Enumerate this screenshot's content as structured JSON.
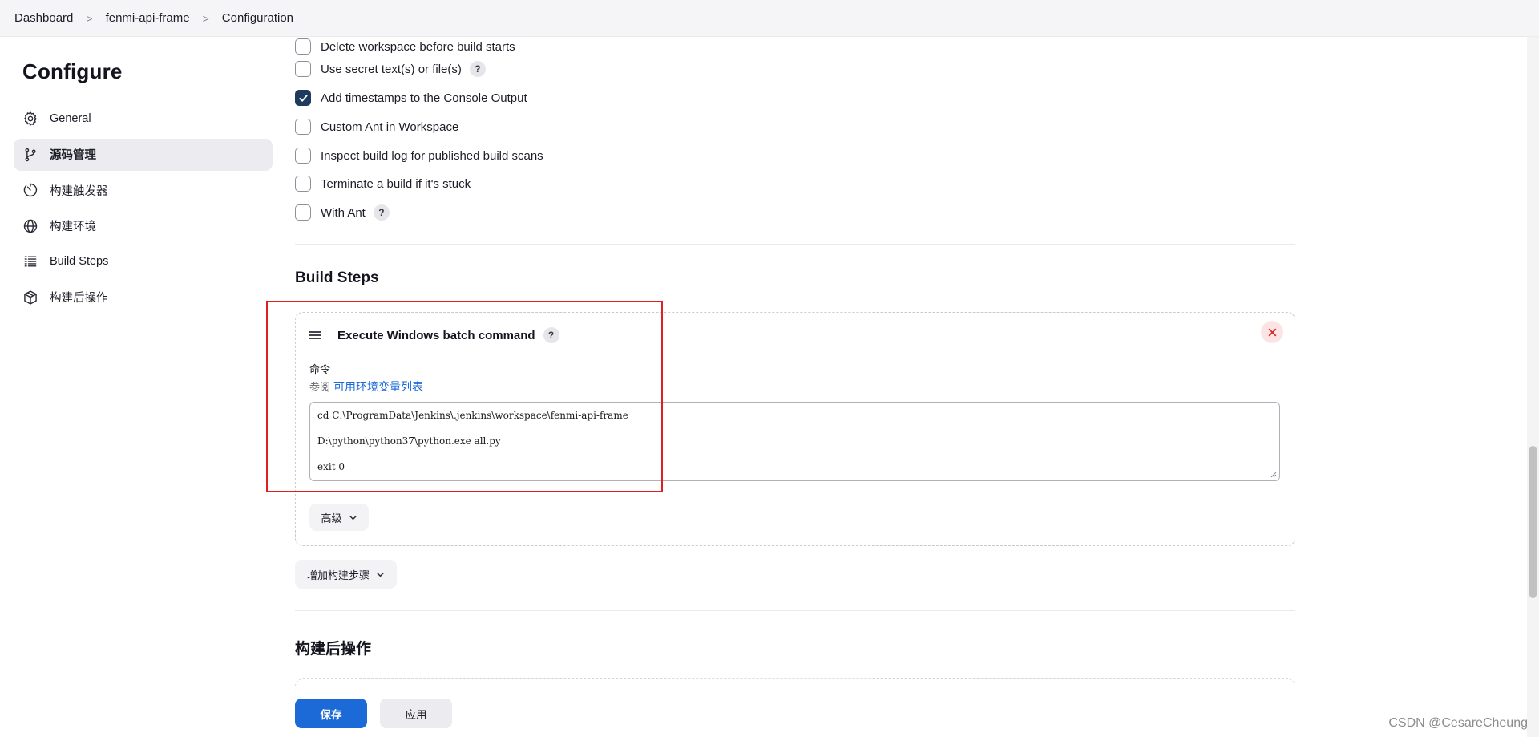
{
  "breadcrumb": {
    "items": [
      "Dashboard",
      "fenmi-api-frame",
      "Configuration"
    ],
    "separator": ">"
  },
  "sidebar": {
    "title": "Configure",
    "items": [
      {
        "label": "General",
        "icon": "gear-icon",
        "active": false
      },
      {
        "label": "源码管理",
        "icon": "git-branch-icon",
        "active": true
      },
      {
        "label": "构建触发器",
        "icon": "timer-icon",
        "active": false
      },
      {
        "label": "构建环境",
        "icon": "globe-icon",
        "active": false
      },
      {
        "label": "Build Steps",
        "icon": "list-icon",
        "active": false
      },
      {
        "label": "构建后操作",
        "icon": "package-icon",
        "active": false
      }
    ]
  },
  "options": [
    {
      "label": "Delete workspace before build starts",
      "checked": false,
      "help": false
    },
    {
      "label": "Use secret text(s) or file(s)",
      "checked": false,
      "help": true
    },
    {
      "label": "Add timestamps to the Console Output",
      "checked": true,
      "help": false
    },
    {
      "label": "Custom Ant in Workspace",
      "checked": false,
      "help": false
    },
    {
      "label": "Inspect build log for published build scans",
      "checked": false,
      "help": false
    },
    {
      "label": "Terminate a build if it's stuck",
      "checked": false,
      "help": false
    },
    {
      "label": "With Ant",
      "checked": false,
      "help": true
    }
  ],
  "build_steps": {
    "section_title": "Build Steps",
    "step": {
      "title": "Execute Windows batch command",
      "help": "?",
      "field_label": "命令",
      "see_also_prefix": "参阅",
      "see_also_link": "可用环境变量列表",
      "command_lines": [
        "cd C:\\ProgramData\\Jenkins\\.jenkins\\workspace\\fenmi-api-frame",
        "D:\\python\\python37\\python.exe all.py",
        "exit 0"
      ],
      "advanced_label": "高级"
    },
    "add_step_label": "增加构建步骤"
  },
  "post_build": {
    "section_title": "构建后操作"
  },
  "footer": {
    "save_label": "保存",
    "apply_label": "应用"
  },
  "watermark": "CSDN @CesareCheung",
  "colors": {
    "primary": "#1c6ad8",
    "checked": "#1e3a5f",
    "annotation": "#e02020",
    "danger_bg": "#fde4e4"
  }
}
